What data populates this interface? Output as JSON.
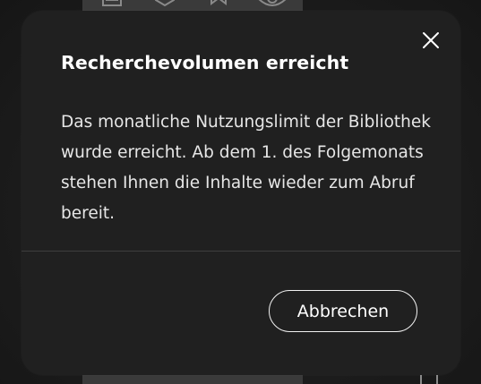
{
  "dialog": {
    "title": "Recherchevolumen erreicht",
    "message": "Das monatliche Nutzungslimit der Bibliothek wurde erreicht. Ab dem 1. des Folgemonats stehen Ihnen die Inhalte wieder zum Abruf bereit.",
    "cancel_label": "Abbrechen",
    "close_icon": "close-icon"
  },
  "colors": {
    "dialog_background": "#202020",
    "text": "#ffffff",
    "button_border": "#f2f2f2"
  }
}
